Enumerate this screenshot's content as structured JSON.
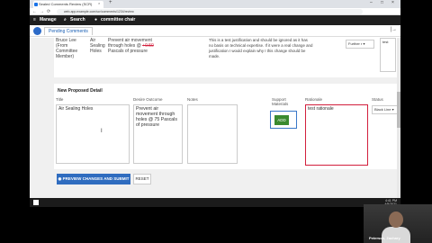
{
  "browser": {
    "tab_title": "Sealed Comments Review (SCR)",
    "tab_close": "×",
    "new_tab": "+",
    "window_controls": [
      "–",
      "□",
      "×"
    ],
    "nav": [
      "←",
      "→",
      "⟳"
    ],
    "url": "web-app.example.com/scr/comments/1234/review"
  },
  "app_nav": {
    "menu_label": "Manage",
    "search_label": "Search",
    "user_label": "committee chair"
  },
  "subbar": {
    "tab_label": "Pending Comments",
    "close_label": "|→"
  },
  "existing_row": {
    "name": [
      "Bruce Lee",
      "(From",
      "Committee",
      "Member)"
    ],
    "section": [
      "Air",
      "Sealing",
      "Holes"
    ],
    "outcome_pre": [
      "Prevent air movement",
      "through holes @ "
    ],
    "outcome_strike": "+0.50",
    "outcome_post": [
      "Pascals of pressure"
    ],
    "justification": [
      "This is a test justification and should be ignored as it has",
      "no basis on technical expertise. If it were a real change and",
      "justification I would explain why I this change should be",
      "made."
    ],
    "status_select": "Further r",
    "note_text": "test"
  },
  "new_detail": {
    "title": "New Proposed Detail",
    "columns": {
      "title": "Title",
      "outcome": "Desire Outcome",
      "notes": "Notes",
      "support": "Support\nMaterials",
      "rationale": "Rationale",
      "status": "Status"
    },
    "title_value": "Air Sealing Holes",
    "outcome_value": "Prevent air movement through holes @ 75 Pascals of pressure",
    "notes_value": "",
    "add_label": "ADD",
    "rationale_value": "test rationale",
    "status_value": "Black Line"
  },
  "actions": {
    "preview_label": "PREVIEW CHANGES AND SUBMIT",
    "reset_label": "RESET"
  },
  "taskbar": {
    "time": "4:41 PM",
    "date": "4/5/2021"
  },
  "video": {
    "participant_name": "Peterson, Zachary"
  },
  "colors": {
    "accent": "#2f6cbf",
    "add_button": "#3a8a2f",
    "rationale_border": "#d21f3c"
  }
}
